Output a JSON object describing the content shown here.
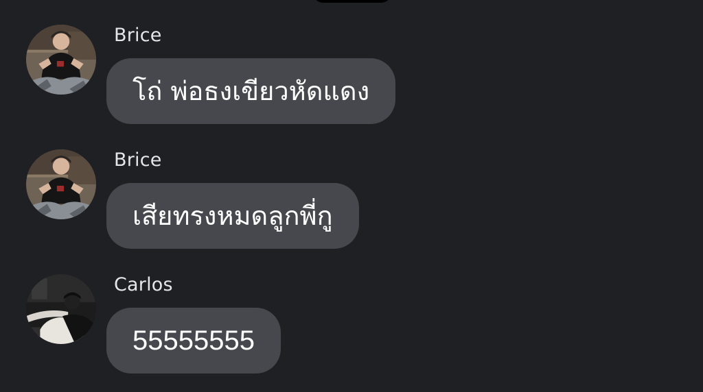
{
  "colors": {
    "background": "#1f2023",
    "bubble": "#47484d",
    "sender_text": "#e6e6e8",
    "message_text": "#ffffff"
  },
  "messages": [
    {
      "sender": "Brice",
      "text": "โถ่ พ่อธงเขียวหัดแดง",
      "avatar": "avatar-brice"
    },
    {
      "sender": "Brice",
      "text": "เสียทรงหมดลูกพี่กู",
      "avatar": "avatar-brice"
    },
    {
      "sender": "Carlos",
      "text": "55555555",
      "avatar": "avatar-carlos"
    }
  ]
}
